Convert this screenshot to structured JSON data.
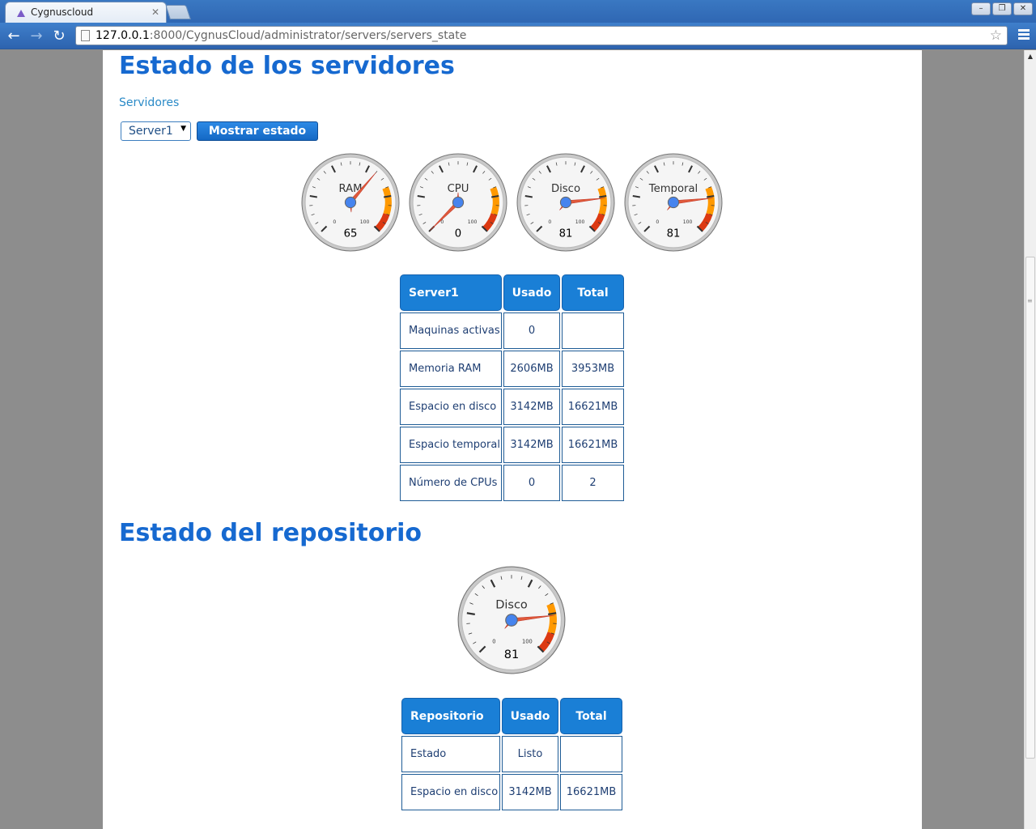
{
  "browser": {
    "tab_title": "Cygnuscloud",
    "url_host": "127.0.0.1",
    "url_rest": ":8000/CygnusCloud/administrator/servers/servers_state"
  },
  "page": {
    "title": "Estado de los servidores",
    "servers_label": "Servidores",
    "select_value": "Server1",
    "show_button": "Mostrar estado",
    "repo_title": "Estado del repositorio"
  },
  "gauges": [
    {
      "label": "RAM",
      "value": 65
    },
    {
      "label": "CPU",
      "value": 0
    },
    {
      "label": "Disco",
      "value": 81
    },
    {
      "label": "Temporal",
      "value": 81
    }
  ],
  "repo_gauge": {
    "label": "Disco",
    "value": 81
  },
  "gauge_scale": {
    "min": "0",
    "max": "100"
  },
  "server_table": {
    "headers": [
      "Server1",
      "Usado",
      "Total"
    ],
    "rows": [
      [
        "Maquinas activas",
        "0",
        ""
      ],
      [
        "Memoria RAM",
        "2606MB",
        "3953MB"
      ],
      [
        "Espacio en disco",
        "3142MB",
        "16621MB"
      ],
      [
        "Espacio temporal",
        "3142MB",
        "16621MB"
      ],
      [
        "Número de CPUs",
        "0",
        "2"
      ]
    ]
  },
  "repo_table": {
    "headers": [
      "Repositorio",
      "Usado",
      "Total"
    ],
    "rows": [
      [
        "Estado",
        "Listo",
        ""
      ],
      [
        "Espacio en disco",
        "3142MB",
        "16621MB"
      ]
    ]
  }
}
